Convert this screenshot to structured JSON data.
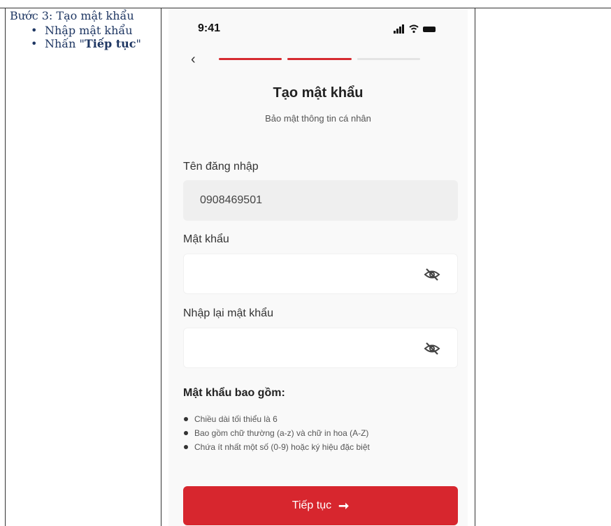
{
  "instructions": {
    "step_title": "Bước 3: Tạo mật khẩu",
    "items": [
      {
        "text": "Nhập mật khẩu"
      },
      {
        "prefix": "Nhấn \"",
        "bold": "Tiếp tục",
        "suffix": "\""
      }
    ],
    "text_color": "#1f3763"
  },
  "phone": {
    "status_bar": {
      "time": "9:41",
      "icons": [
        "signal-icon",
        "wifi-icon",
        "battery-icon"
      ]
    },
    "back_icon": "chevron-left-icon",
    "progress": {
      "completed_steps": 2,
      "total_steps": 3,
      "active_color": "#d62a30",
      "inactive_color": "#e4e4e4"
    },
    "title": "Tạo mật khẩu",
    "subtitle": "Bảo mật thông tin cá nhân",
    "username": {
      "label": "Tên đăng nhập",
      "value": "0908469501"
    },
    "password": {
      "label": "Mật khẩu",
      "value": "",
      "toggle_icon": "eye-off-icon"
    },
    "confirm_password": {
      "label": "Nhập lại mật khẩu",
      "value": "",
      "toggle_icon": "eye-off-icon"
    },
    "requirements": {
      "title": "Mật khẩu bao gồm:",
      "items": [
        "Chiều dài tối thiểu là 6",
        "Bao gồm chữ thường (a-z) và chữ in hoa (A-Z)",
        "Chứa ít nhất một số (0-9) hoặc ký hiệu đặc biệt"
      ]
    },
    "continue_button": {
      "label": "Tiếp tục",
      "icon": "arrow-right-icon",
      "color": "#d7262e"
    }
  }
}
